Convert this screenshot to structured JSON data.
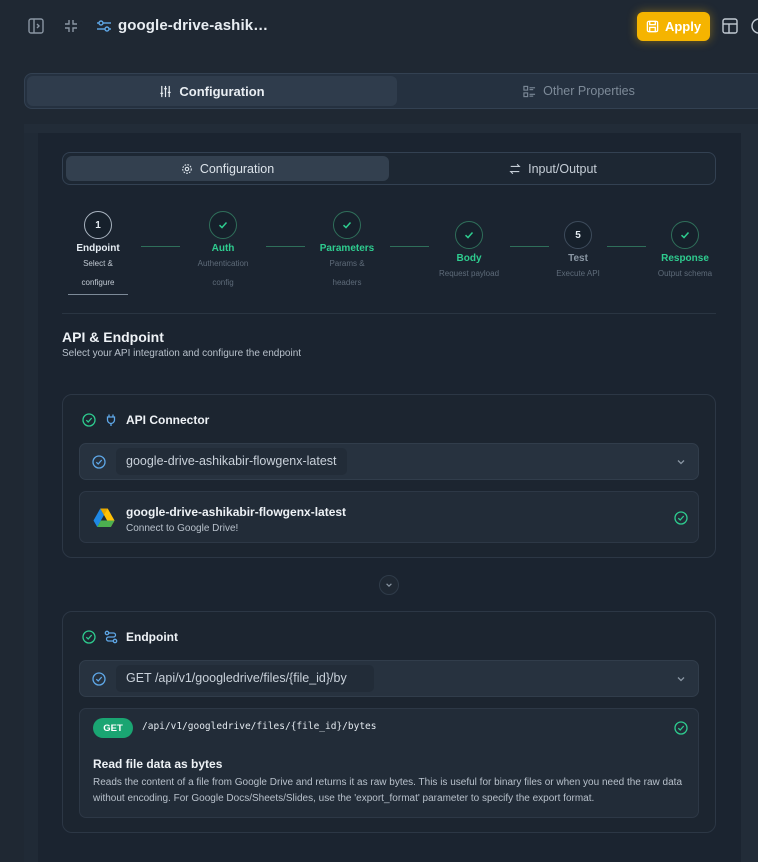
{
  "header": {
    "title": "google-drive-ashik…",
    "apply_label": "Apply"
  },
  "outer_tabs": [
    {
      "label": "Configuration",
      "active": true
    },
    {
      "label": "Other Properties",
      "active": false
    }
  ],
  "inner_tabs": [
    {
      "label": "Configuration",
      "active": true
    },
    {
      "label": "Input/Output",
      "active": false
    }
  ],
  "steps": [
    {
      "number": "1",
      "label": "Endpoint",
      "sub1": "Select &",
      "sub2": "configure",
      "state": "current"
    },
    {
      "label": "Auth",
      "sub1": "Authentication",
      "sub2": "config",
      "state": "done"
    },
    {
      "label": "Parameters",
      "sub1": "Params &",
      "sub2": "headers",
      "state": "done"
    },
    {
      "label": "Body",
      "sub1": "Request payload",
      "state": "done"
    },
    {
      "number": "5",
      "label": "Test",
      "sub1": "Execute API",
      "state": "pending"
    },
    {
      "label": "Response",
      "sub1": "Output schema",
      "state": "done"
    }
  ],
  "section": {
    "title": "API & Endpoint",
    "subtitle": "Select your API integration and configure the endpoint"
  },
  "connector_card": {
    "heading": "API Connector",
    "selected": "google-drive-ashikabir-flowgenx-latest",
    "detail_title": "google-drive-ashikabir-flowgenx-latest",
    "detail_desc": "Connect to Google Drive!"
  },
  "endpoint_card": {
    "heading": "Endpoint",
    "selected": "GET /api/v1/googledrive/files/{file_id}/by",
    "method": "GET",
    "path": "/api/v1/googledrive/files/{file_id}/bytes",
    "title": "Read file data as bytes",
    "description": "Reads the content of a file from Google Drive and returns it as raw bytes. This is useful for binary files or when you need the raw data without encoding. For Google Docs/Sheets/Slides, use the 'export_format' parameter to specify the export format."
  },
  "colors": {
    "accent_green": "#2ecc8f",
    "apply_yellow": "#f5b400",
    "background": "#1f2833"
  }
}
